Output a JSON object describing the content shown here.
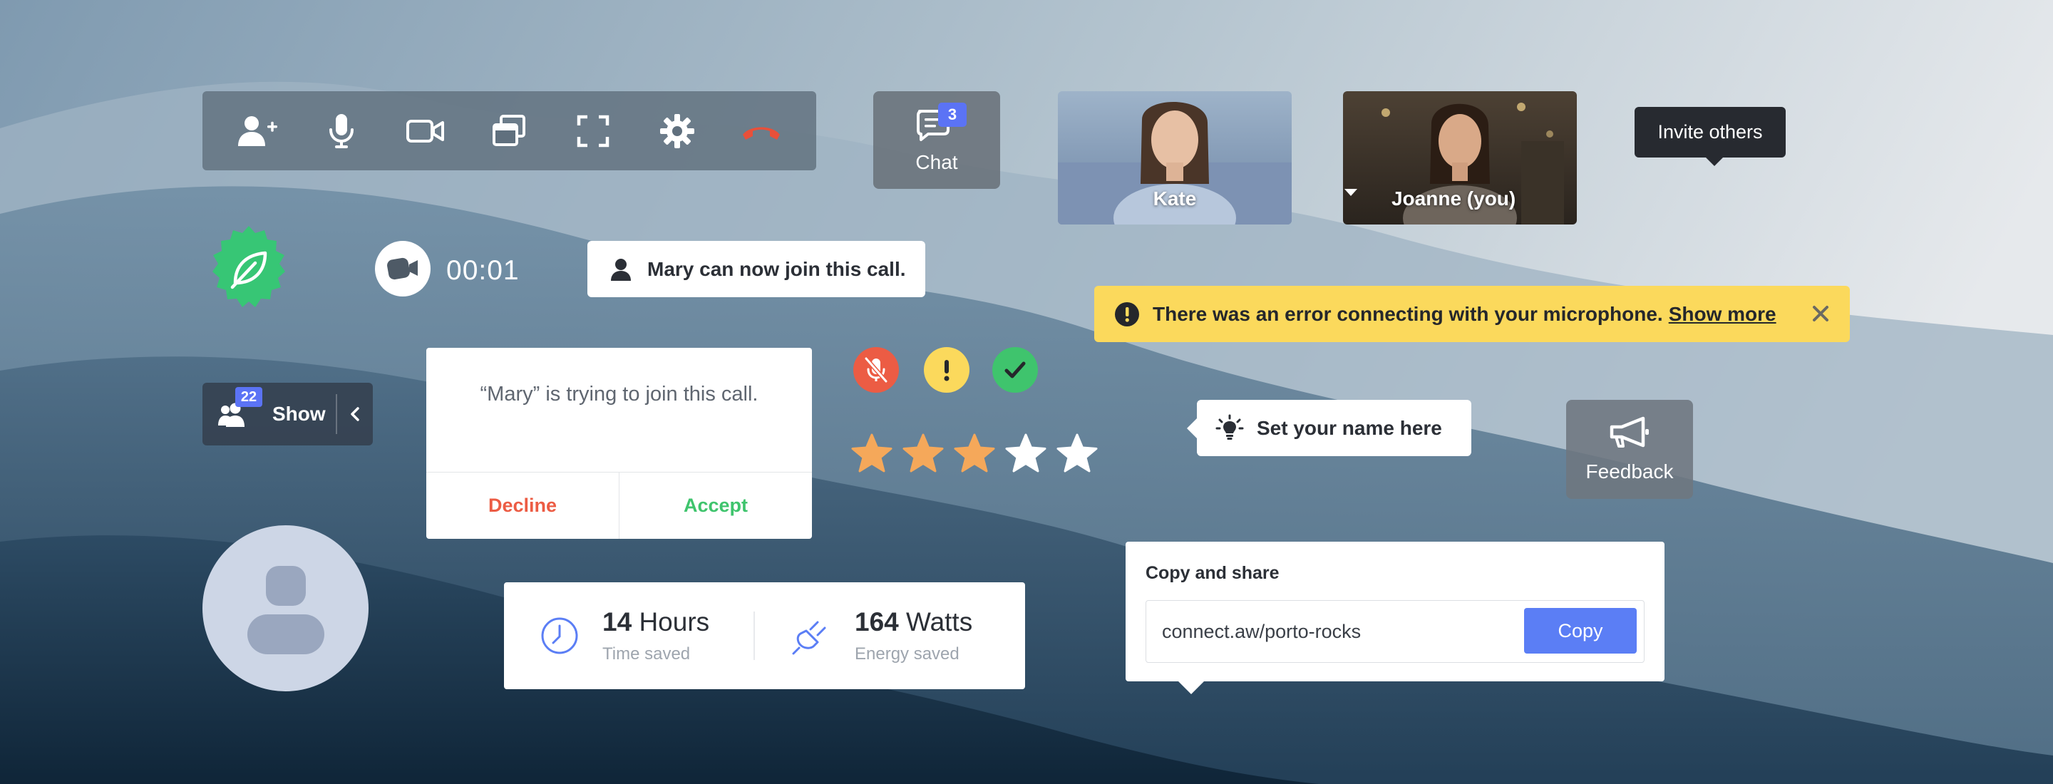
{
  "toolbar": {
    "items": [
      {
        "icon": "add-user-icon"
      },
      {
        "icon": "microphone-icon"
      },
      {
        "icon": "camera-icon"
      },
      {
        "icon": "screen-share-icon"
      },
      {
        "icon": "fullscreen-icon"
      },
      {
        "icon": "settings-icon"
      },
      {
        "icon": "hang-up-icon",
        "color": "#e8503a"
      }
    ]
  },
  "chat": {
    "label": "Chat",
    "badge": "3",
    "badge_color": "#5b73f5"
  },
  "tiles": [
    {
      "name": "Kate"
    },
    {
      "name": "Joanne (you)",
      "has_dropdown": true
    }
  ],
  "tooltip": {
    "text": "Invite others"
  },
  "timer": {
    "value": "00:01"
  },
  "notification": {
    "text": "Mary can now join this call."
  },
  "error": {
    "message": "There was an error connecting with your microphone.",
    "link": "Show more",
    "color": "#fbd95c"
  },
  "participants": {
    "count": "22",
    "label": "Show"
  },
  "join_dialog": {
    "message": "“Mary” is trying to join this call.",
    "decline_label": "Decline",
    "accept_label": "Accept",
    "decline_color": "#ec5c44",
    "accept_color": "#3fc46d"
  },
  "status_icons": [
    {
      "icon": "mic-muted-icon",
      "color": "#ec5c44"
    },
    {
      "icon": "warning-icon",
      "color": "#fbd95c"
    },
    {
      "icon": "check-icon",
      "color": "#3fc46d"
    }
  ],
  "rating": {
    "value": 3,
    "max": 5,
    "filled_color": "#f5a85a",
    "empty_color": "#ffffff"
  },
  "name_input": {
    "placeholder": "Set your name here"
  },
  "feedback": {
    "label": "Feedback"
  },
  "stats": [
    {
      "value": "14",
      "unit": "Hours",
      "label": "Time saved",
      "icon": "clock-icon"
    },
    {
      "value": "164",
      "unit": "Watts",
      "label": "Energy saved",
      "icon": "plug-icon"
    }
  ],
  "share": {
    "title": "Copy and share",
    "url": "connect.aw/porto-rocks",
    "button": "Copy",
    "button_color": "#5b7ef5"
  }
}
